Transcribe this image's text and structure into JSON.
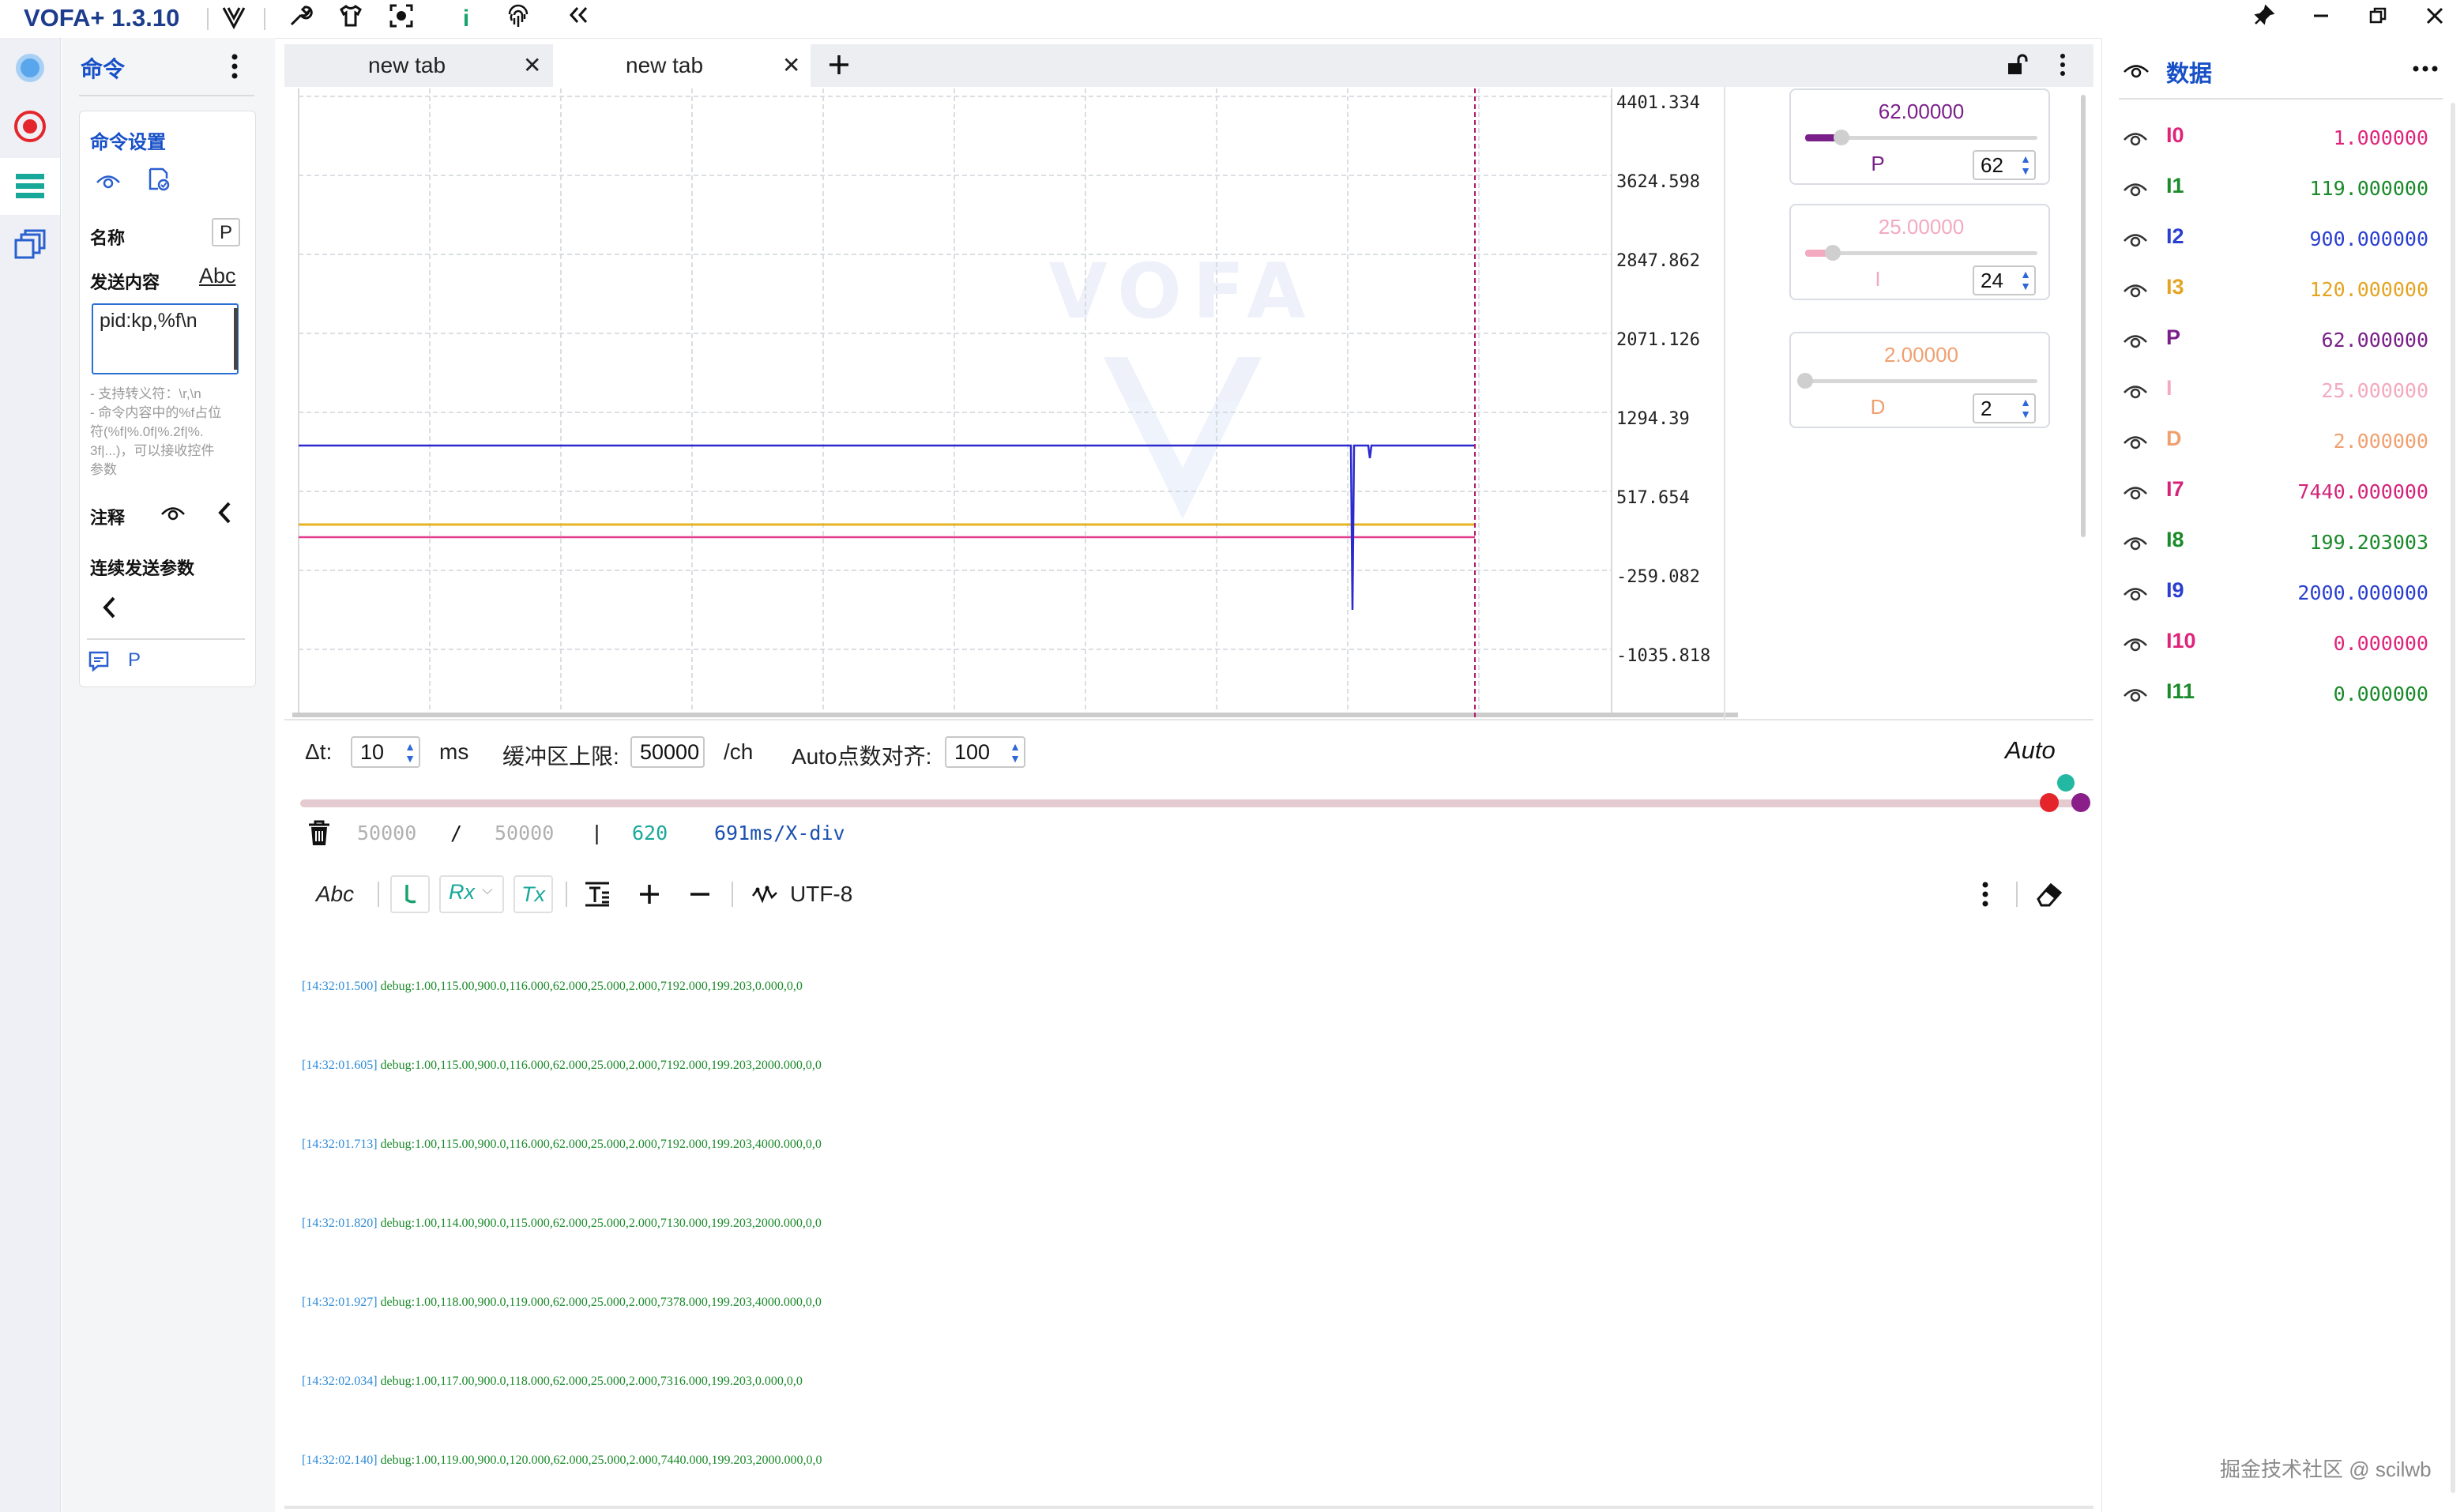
{
  "app": {
    "title": "VOFA+ 1.3.10"
  },
  "colors": {
    "accent": "#1750c7",
    "plot_blue": "#2a2ad0",
    "plot_yellow": "#e4b421",
    "plot_pink": "#e23c8c",
    "cursor_line": "#b01a6a"
  },
  "command_panel": {
    "title": "命令",
    "settings_title": "命令设置",
    "name_label": "名称",
    "name_value": "P",
    "send_label": "发送内容",
    "send_mode": "Abc",
    "send_content": "pid:kp,%f\\n",
    "hints": [
      "- 支持转义符：\\r,\\n",
      "- 命令内容中的%f占位",
      "符(%f|%.0f|%.2f|%.",
      "3f|...)，可以接收控件",
      "参数"
    ],
    "comment_label": "注释",
    "continuous_label": "连续发送参数",
    "command_item": "P"
  },
  "tabs": [
    {
      "label": "new tab"
    },
    {
      "label": "new tab"
    }
  ],
  "plot": {
    "y_ticks": [
      "4401.334",
      "3624.598",
      "2847.862",
      "2071.126",
      "1294.39",
      "517.654",
      "-259.082",
      "-1035.818"
    ]
  },
  "sliders": [
    {
      "value_text": "62.00000",
      "name": "P",
      "spin_value": "62",
      "fraction": 0.155,
      "color": "#7a1f8a"
    },
    {
      "value_text": "25.00000",
      "name": "I",
      "spin_value": "24",
      "fraction": 0.12,
      "color": "#f3a9bf"
    },
    {
      "value_text": "2.00000",
      "name": "D",
      "spin_value": "2",
      "fraction": 0.0,
      "color": "#f0a070"
    }
  ],
  "controls": {
    "dt_label": "Δt:",
    "dt_value": "10",
    "dt_unit": "ms",
    "buffer_label": "缓冲区上限:",
    "buffer_value": "50000",
    "buffer_unit": "/ch",
    "auto_align_label": "Auto点数对齐:",
    "auto_align_value": "100",
    "auto_label": "Auto"
  },
  "stats": {
    "count_current": "50000",
    "sep1": "/",
    "count_total": "50000",
    "sep2": "|",
    "points": "620",
    "xdiv": "691ms/X-div"
  },
  "rx_toolbar": {
    "mode": "Abc",
    "rx": "Rx",
    "tx": "Tx",
    "encoding": "UTF-8"
  },
  "log": [
    {
      "time": "[14:32:01.500]",
      "msg": "debug:1.00,115.00,900.0,116.000,62.000,25.000,2.000,7192.000,199.203,0.000,0,0"
    },
    {
      "time": "[14:32:01.605]",
      "msg": "debug:1.00,115.00,900.0,116.000,62.000,25.000,2.000,7192.000,199.203,2000.000,0,0"
    },
    {
      "time": "[14:32:01.713]",
      "msg": "debug:1.00,115.00,900.0,116.000,62.000,25.000,2.000,7192.000,199.203,4000.000,0,0"
    },
    {
      "time": "[14:32:01.820]",
      "msg": "debug:1.00,114.00,900.0,115.000,62.000,25.000,2.000,7130.000,199.203,2000.000,0,0"
    },
    {
      "time": "[14:32:01.927]",
      "msg": "debug:1.00,118.00,900.0,119.000,62.000,25.000,2.000,7378.000,199.203,4000.000,0,0"
    },
    {
      "time": "[14:32:02.034]",
      "msg": "debug:1.00,117.00,900.0,118.000,62.000,25.000,2.000,7316.000,199.203,0.000,0,0"
    },
    {
      "time": "[14:32:02.140]",
      "msg": "debug:1.00,119.00,900.0,120.000,62.000,25.000,2.000,7440.000,199.203,2000.000,0,0"
    }
  ],
  "data_panel": {
    "title": "数据",
    "items": [
      {
        "name": "I0",
        "value": "1.000000",
        "color": "#e0237a"
      },
      {
        "name": "I1",
        "value": "119.000000",
        "color": "#1a8a2a"
      },
      {
        "name": "I2",
        "value": "900.000000",
        "color": "#2a3fd0"
      },
      {
        "name": "I3",
        "value": "120.000000",
        "color": "#e4a421"
      },
      {
        "name": "P",
        "value": "62.000000",
        "color": "#7a1f8a"
      },
      {
        "name": "I",
        "value": "25.000000",
        "color": "#f3a9bf"
      },
      {
        "name": "D",
        "value": "2.000000",
        "color": "#f0a070"
      },
      {
        "name": "I7",
        "value": "7440.000000",
        "color": "#d4237a"
      },
      {
        "name": "I8",
        "value": "199.203003",
        "color": "#1a8a2a"
      },
      {
        "name": "I9",
        "value": "2000.000000",
        "color": "#2a3fd0"
      },
      {
        "name": "I10",
        "value": "0.000000",
        "color": "#e0237a"
      },
      {
        "name": "I11",
        "value": "0.000000",
        "color": "#1a8a2a"
      }
    ]
  },
  "watermark": "掘金技术社区 @ scilwb"
}
